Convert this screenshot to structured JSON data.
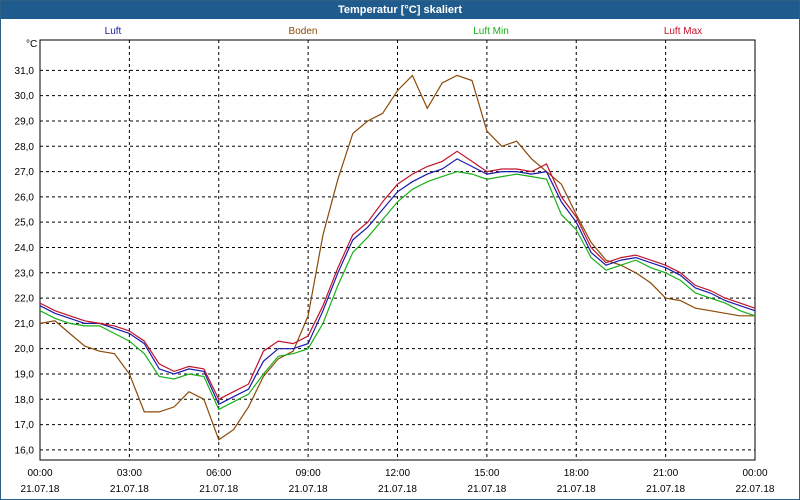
{
  "window": {
    "title": "Temperatur [°C] skaliert"
  },
  "chart_data": {
    "type": "line",
    "title": "Temperatur [°C] skaliert",
    "ylabel": "°C",
    "xlabel": "",
    "ylim": [
      15.6,
      32.2
    ],
    "xlim_hours": [
      0,
      24
    ],
    "grid": true,
    "legend_position": "top",
    "y_ticks": [
      "16,0",
      "17,0",
      "18,0",
      "19,0",
      "20,0",
      "21,0",
      "22,0",
      "23,0",
      "24,0",
      "25,0",
      "26,0",
      "27,0",
      "28,0",
      "29,0",
      "30,0",
      "31,0"
    ],
    "x_ticks": [
      {
        "time": "00:00",
        "date": "21.07.18"
      },
      {
        "time": "03:00",
        "date": "21.07.18"
      },
      {
        "time": "06:00",
        "date": "21.07.18"
      },
      {
        "time": "09:00",
        "date": "21.07.18"
      },
      {
        "time": "12:00",
        "date": "21.07.18"
      },
      {
        "time": "15:00",
        "date": "21.07.18"
      },
      {
        "time": "18:00",
        "date": "21.07.18"
      },
      {
        "time": "21:00",
        "date": "21.07.18"
      },
      {
        "time": "00:00",
        "date": "22.07.18"
      }
    ],
    "x": [
      "00:00",
      "00:30",
      "01:00",
      "01:30",
      "02:00",
      "02:30",
      "03:00",
      "03:30",
      "04:00",
      "04:30",
      "05:00",
      "05:30",
      "06:00",
      "06:30",
      "07:00",
      "07:30",
      "08:00",
      "08:30",
      "09:00",
      "09:30",
      "10:00",
      "10:30",
      "11:00",
      "11:30",
      "12:00",
      "12:30",
      "13:00",
      "13:30",
      "14:00",
      "14:30",
      "15:00",
      "15:30",
      "16:00",
      "16:30",
      "17:00",
      "17:30",
      "18:00",
      "18:30",
      "19:00",
      "19:30",
      "20:00",
      "20:30",
      "21:00",
      "21:30",
      "22:00",
      "22:30",
      "23:00",
      "23:30",
      "24:00"
    ],
    "series": [
      {
        "name": "Luft",
        "color": "#1a1aa8",
        "values": [
          21.7,
          21.4,
          21.2,
          21.0,
          21.0,
          20.8,
          20.6,
          20.2,
          19.2,
          19.0,
          19.2,
          19.1,
          17.8,
          18.1,
          18.4,
          19.5,
          20.0,
          20.0,
          20.2,
          21.5,
          23.0,
          24.3,
          24.8,
          25.5,
          26.2,
          26.6,
          26.9,
          27.1,
          27.5,
          27.2,
          26.9,
          27.0,
          27.0,
          26.9,
          27.0,
          25.8,
          25.0,
          23.8,
          23.3,
          23.5,
          23.6,
          23.4,
          23.2,
          22.9,
          22.4,
          22.2,
          21.9,
          21.7,
          21.5
        ]
      },
      {
        "name": "Boden",
        "color": "#8b4a08",
        "values": [
          21.0,
          21.1,
          20.6,
          20.1,
          19.9,
          19.8,
          19.0,
          17.5,
          17.5,
          17.7,
          18.3,
          18.0,
          16.4,
          16.8,
          17.7,
          18.9,
          19.6,
          19.9,
          21.3,
          24.5,
          26.7,
          28.5,
          29.0,
          29.3,
          30.2,
          30.8,
          29.5,
          30.5,
          30.8,
          30.6,
          28.6,
          28.0,
          28.2,
          27.5,
          27.0,
          26.5,
          25.3,
          24.2,
          23.5,
          23.3,
          23.0,
          22.6,
          22.0,
          21.9,
          21.6,
          21.5,
          21.4,
          21.3,
          21.3
        ]
      },
      {
        "name": "Luft Min",
        "color": "#18b018",
        "values": [
          21.5,
          21.2,
          21.0,
          20.9,
          20.9,
          20.6,
          20.3,
          19.8,
          18.9,
          18.8,
          19.0,
          18.9,
          17.6,
          17.9,
          18.2,
          19.0,
          19.7,
          19.8,
          20.0,
          21.0,
          22.5,
          23.8,
          24.4,
          25.1,
          25.8,
          26.3,
          26.6,
          26.8,
          27.0,
          26.9,
          26.7,
          26.8,
          26.9,
          26.8,
          26.7,
          25.3,
          24.7,
          23.6,
          23.1,
          23.3,
          23.5,
          23.2,
          23.0,
          22.7,
          22.2,
          22.0,
          21.8,
          21.5,
          21.3
        ]
      },
      {
        "name": "Luft Max",
        "color": "#c0142c",
        "values": [
          21.8,
          21.5,
          21.3,
          21.1,
          21.0,
          20.9,
          20.7,
          20.3,
          19.4,
          19.1,
          19.3,
          19.2,
          18.0,
          18.3,
          18.6,
          19.9,
          20.3,
          20.2,
          20.5,
          21.7,
          23.2,
          24.5,
          25.0,
          25.8,
          26.5,
          26.9,
          27.2,
          27.4,
          27.8,
          27.4,
          27.0,
          27.1,
          27.1,
          27.0,
          27.3,
          26.0,
          25.2,
          24.0,
          23.4,
          23.6,
          23.7,
          23.5,
          23.3,
          23.0,
          22.5,
          22.3,
          22.0,
          21.8,
          21.6
        ]
      }
    ]
  }
}
